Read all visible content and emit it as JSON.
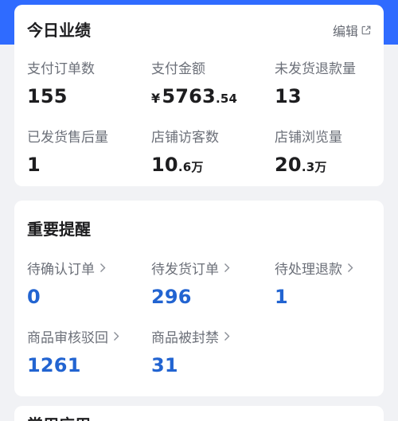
{
  "performance": {
    "title": "今日业绩",
    "edit_label": "编辑",
    "metrics": [
      {
        "label": "支付订单数",
        "main": "155",
        "small": ""
      },
      {
        "label": "支付金额",
        "currency": "¥",
        "main": "5763",
        "small": ".54"
      },
      {
        "label": "未发货退款量",
        "main": "13",
        "small": ""
      },
      {
        "label": "已发货售后量",
        "main": "1",
        "small": ""
      },
      {
        "label": "店铺访客数",
        "main": "10",
        "small": ".6万"
      },
      {
        "label": "店铺浏览量",
        "main": "20",
        "small": ".3万"
      }
    ]
  },
  "reminders": {
    "title": "重要提醒",
    "items": [
      {
        "label": "待确认订单",
        "value": "0"
      },
      {
        "label": "待发货订单",
        "value": "296"
      },
      {
        "label": "待处理退款",
        "value": "1"
      },
      {
        "label": "商品审核驳回",
        "value": "1261"
      },
      {
        "label": "商品被封禁",
        "value": "31"
      }
    ]
  },
  "apps": {
    "title": "常用应用"
  },
  "colors": {
    "accent": "#2f6bff",
    "value_blue": "#2264d1",
    "text_dark": "#1d1d1f",
    "text_gray": "#6b6f78"
  }
}
